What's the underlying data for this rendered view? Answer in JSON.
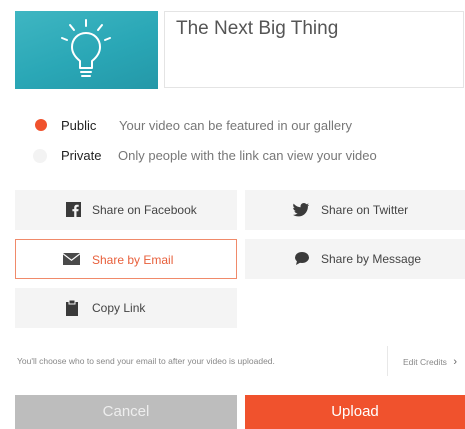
{
  "project": {
    "title": "The Next Big Thing",
    "thumbnail_icon": "lightbulb-icon",
    "thumbnail_color": "#2aa7b6"
  },
  "visibility": {
    "options": [
      {
        "label": "Public",
        "description": "Your video can be featured in our gallery",
        "selected": true
      },
      {
        "label": "Private",
        "description": "Only people with the link can view your video",
        "selected": false
      }
    ]
  },
  "share": {
    "facebook": {
      "label": "Share on Facebook",
      "icon": "facebook-icon"
    },
    "twitter": {
      "label": "Share on Twitter",
      "icon": "twitter-icon"
    },
    "email": {
      "label": "Share by Email",
      "icon": "envelope-icon",
      "selected": true
    },
    "message": {
      "label": "Share by Message",
      "icon": "chat-bubble-icon"
    },
    "copy": {
      "label": "Copy Link",
      "icon": "clipboard-icon"
    }
  },
  "footer": {
    "note": "You'll choose who to send your email to after your video is uploaded.",
    "edit_credits": "Edit Credits",
    "edit_credits_chevron": "›"
  },
  "actions": {
    "cancel": "Cancel",
    "upload": "Upload"
  },
  "colors": {
    "accent": "#f0522d",
    "selected_border": "#f08a6a",
    "button_bg": "#f4f4f4",
    "cancel_bg": "#bdbdbd"
  }
}
